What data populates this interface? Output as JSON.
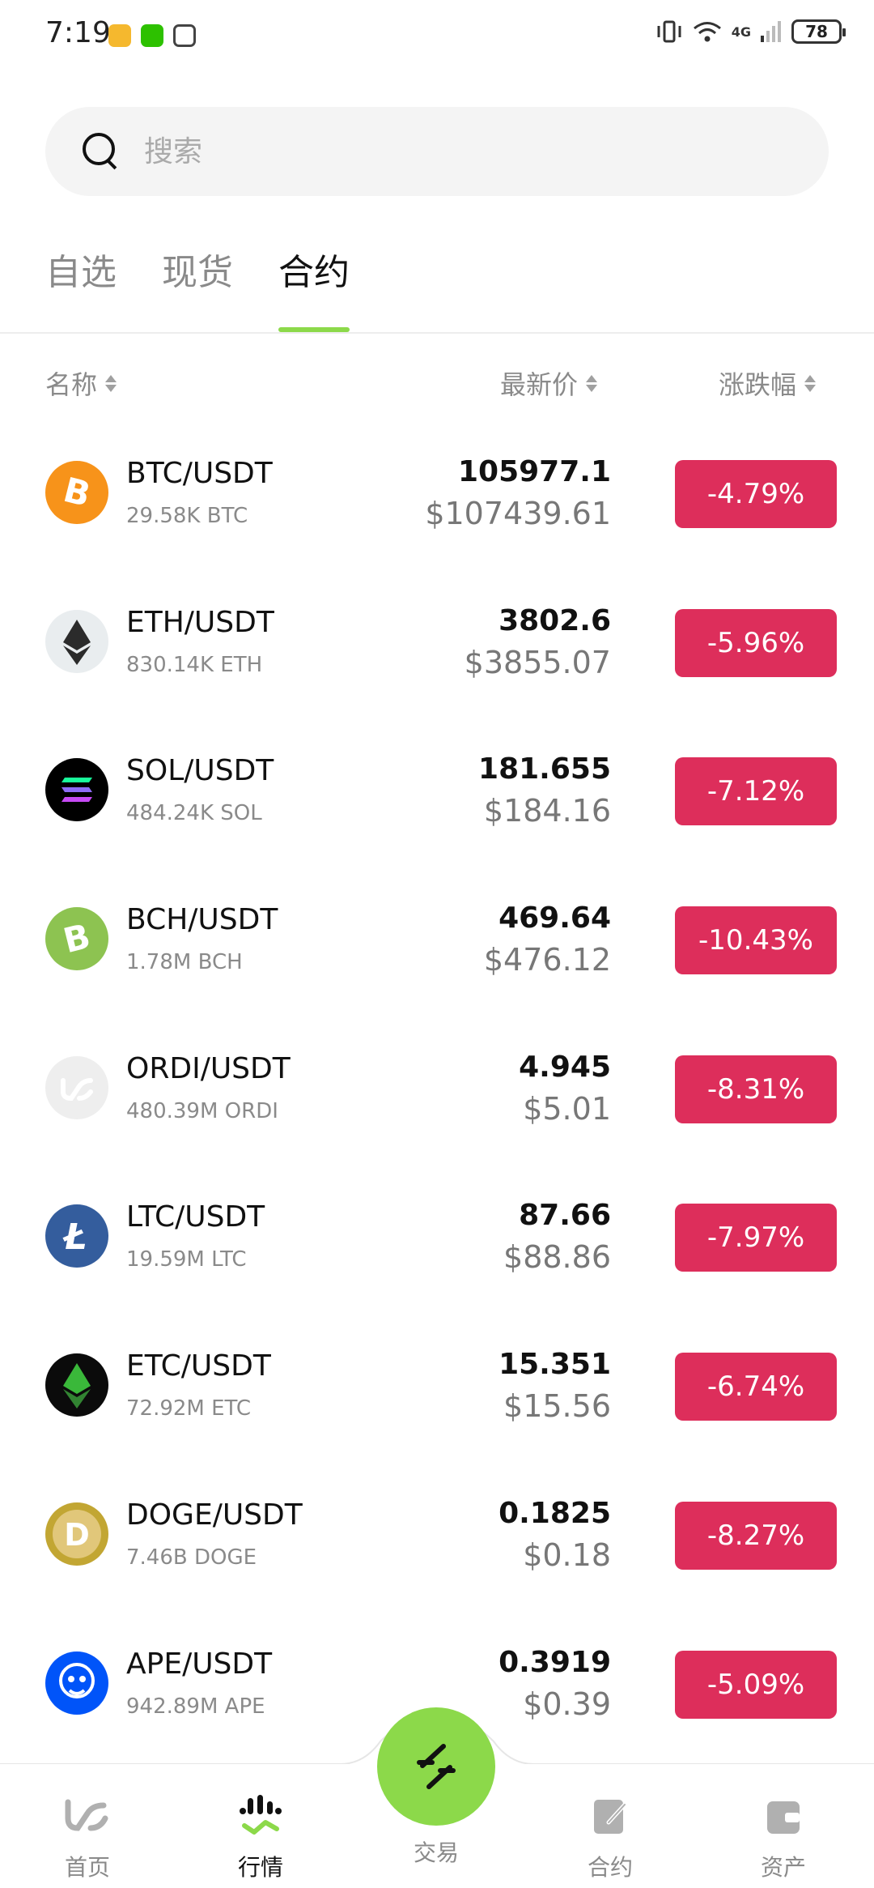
{
  "status_bar": {
    "time": "7:19",
    "network": "4G",
    "battery": "78"
  },
  "search": {
    "placeholder": "搜索"
  },
  "tabs": [
    {
      "label": "自选",
      "active": false
    },
    {
      "label": "现货",
      "active": false
    },
    {
      "label": "合约",
      "active": true
    }
  ],
  "columns": {
    "name": "名称",
    "price": "最新价",
    "change": "涨跌幅"
  },
  "markets": [
    {
      "pair": "BTC/USDT",
      "volume": "29.58K BTC",
      "price": "105977.1",
      "fiat": "$107439.61",
      "change": "-4.79%",
      "icon": "btc-icon",
      "color": "#f7931a"
    },
    {
      "pair": "ETH/USDT",
      "volume": "830.14K ETH",
      "price": "3802.6",
      "fiat": "$3855.07",
      "change": "-5.96%",
      "icon": "eth-icon",
      "color": "#e9edef"
    },
    {
      "pair": "SOL/USDT",
      "volume": "484.24K SOL",
      "price": "181.655",
      "fiat": "$184.16",
      "change": "-7.12%",
      "icon": "sol-icon",
      "color": "#000000"
    },
    {
      "pair": "BCH/USDT",
      "volume": "1.78M BCH",
      "price": "469.64",
      "fiat": "$476.12",
      "change": "-10.43%",
      "icon": "bch-icon",
      "color": "#8dc351"
    },
    {
      "pair": "ORDI/USDT",
      "volume": "480.39M ORDI",
      "price": "4.945",
      "fiat": "$5.01",
      "change": "-8.31%",
      "icon": "ordi-icon",
      "color": "#eeeeee"
    },
    {
      "pair": "LTC/USDT",
      "volume": "19.59M LTC",
      "price": "87.66",
      "fiat": "$88.86",
      "change": "-7.97%",
      "icon": "ltc-icon",
      "color": "#345d9d"
    },
    {
      "pair": "ETC/USDT",
      "volume": "72.92M ETC",
      "price": "15.351",
      "fiat": "$15.56",
      "change": "-6.74%",
      "icon": "etc-icon",
      "color": "#0b0b0b"
    },
    {
      "pair": "DOGE/USDT",
      "volume": "7.46B DOGE",
      "price": "0.1825",
      "fiat": "$0.18",
      "change": "-8.27%",
      "icon": "doge-icon",
      "color": "#c2a633"
    },
    {
      "pair": "APE/USDT",
      "volume": "942.89M APE",
      "price": "0.3919",
      "fiat": "$0.39",
      "change": "-5.09%",
      "icon": "ape-icon",
      "color": "#0054f9"
    }
  ],
  "nav": {
    "home": "首页",
    "market": "行情",
    "trade": "交易",
    "futures": "合约",
    "assets": "资产"
  },
  "colors": {
    "accent": "#8cd94a",
    "down": "#dd2e5b"
  }
}
